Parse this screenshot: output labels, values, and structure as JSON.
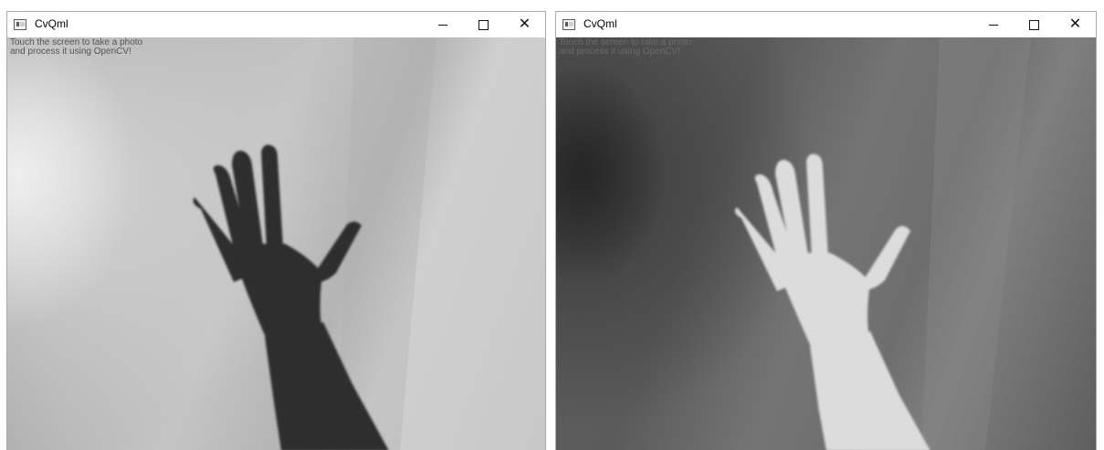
{
  "windows": [
    {
      "title": "CvQml",
      "overlay_lines": [
        "Touch the screen to take a photo",
        "and process it using OpenCV!"
      ],
      "image": "grayscale photo of a raised hand"
    },
    {
      "title": "CvQml",
      "overlay_lines": [
        "Touch the screen to take a photo",
        "and process it using OpenCV!"
      ],
      "image": "inverted photo of a raised hand"
    }
  ],
  "controls": {
    "minimize_icon": "minimize-icon",
    "maximize_icon": "maximize-icon",
    "close_icon": "close-icon"
  },
  "colors": {
    "hand_original": "#2f2f2f",
    "hand_inverted": "#dcdcdc"
  }
}
